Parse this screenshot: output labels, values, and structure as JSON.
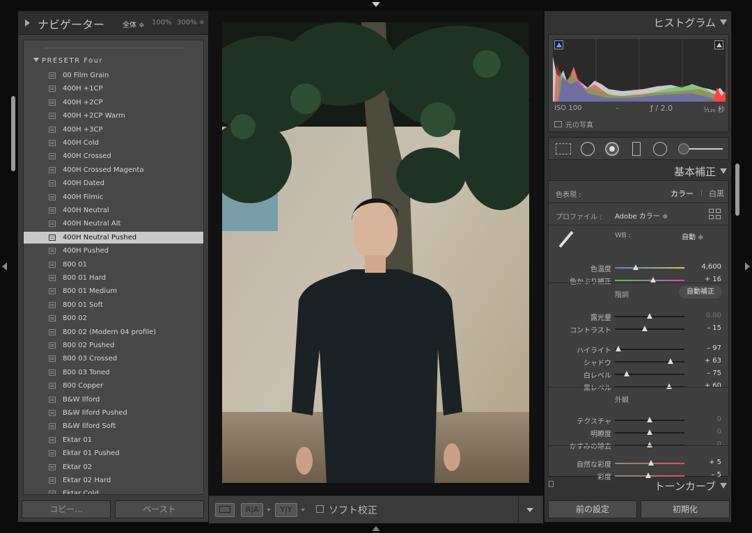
{
  "navigator": {
    "title": "ナビゲーター",
    "zoom_fit": "全体 ≑",
    "zoom_100": "100%",
    "zoom_300": "300% ≑"
  },
  "presets": {
    "group_label": "PRESETR Four",
    "items": [
      "00 Film Grain",
      "400H +1CP",
      "400H +2CP",
      "400H +2CP Warm",
      "400H +3CP",
      "400H Cold",
      "400H Crossed",
      "400H Crossed Magenta",
      "400H Dated",
      "400H Filmic",
      "400H Neutral",
      "400H Neutral Alt",
      "400H Neutral Pushed",
      "400H Pushed",
      "800 01",
      "800 01 Hard",
      "800 01 Medium",
      "800 01 Soft",
      "800 02",
      "800 02 (Modern 04 profile)",
      "800 02 Pushed",
      "800 03 Crossed",
      "800 03 Toned",
      "800 Copper",
      "B&W Ilford",
      "B&W Ilford Pushed",
      "B&W Ilford Soft",
      "Ektar 01",
      "Ektar 01 Pushed",
      "Ektar 02",
      "Ektar 02 Hard",
      "Ektar Cold"
    ],
    "selected_index": 12
  },
  "left_buttons": {
    "copy": "コピー...",
    "paste": "ペースト"
  },
  "toolbar": {
    "ra": "R|A",
    "yy": "Y|Y",
    "soft_proof": "ソフト校正"
  },
  "histogram": {
    "title": "ヒストグラム",
    "iso": "ISO 100",
    "dash": "–",
    "aperture": "ƒ / 2.0",
    "shutter": "¹⁄₁₂₅ 秒",
    "original_photo": "元の写真"
  },
  "basic": {
    "title": "基本補正",
    "treatment_label": "色表現 :",
    "color": "カラー",
    "bw": "白黒",
    "profile_label": "プロファイル :",
    "profile_value": "Adobe カラー ≑",
    "wb_label": "WB :",
    "wb_value": "自動 ≑",
    "tone_label": "階調",
    "auto": "自動補正",
    "presence_label": "外観",
    "sliders": [
      {
        "name": "色温度",
        "value": "4,600",
        "pos": 0.3
      },
      {
        "name": "色かぶり補正",
        "value": "+ 16",
        "pos": 0.55
      },
      {
        "name": "露光量",
        "value": "0.00",
        "pos": 0.5
      },
      {
        "name": "コントラスト",
        "value": "– 15",
        "pos": 0.43
      },
      {
        "name": "ハイライト",
        "value": "– 97",
        "pos": 0.05
      },
      {
        "name": "シャドウ",
        "value": "+ 63",
        "pos": 0.8
      },
      {
        "name": "白レベル",
        "value": "– 75",
        "pos": 0.17
      },
      {
        "name": "黒レベル",
        "value": "+ 60",
        "pos": 0.78
      },
      {
        "name": "テクスチャ",
        "value": "0",
        "pos": 0.5
      },
      {
        "name": "明瞭度",
        "value": "0",
        "pos": 0.5
      },
      {
        "name": "かすみの除去",
        "value": "0",
        "pos": 0.5
      },
      {
        "name": "自然な彩度",
        "value": "+ 5",
        "pos": 0.52
      },
      {
        "name": "彩度",
        "value": "– 5",
        "pos": 0.48
      }
    ]
  },
  "tone_curve": {
    "title": "トーンカーブ"
  },
  "right_buttons": {
    "previous": "前の設定",
    "reset": "初期化"
  }
}
